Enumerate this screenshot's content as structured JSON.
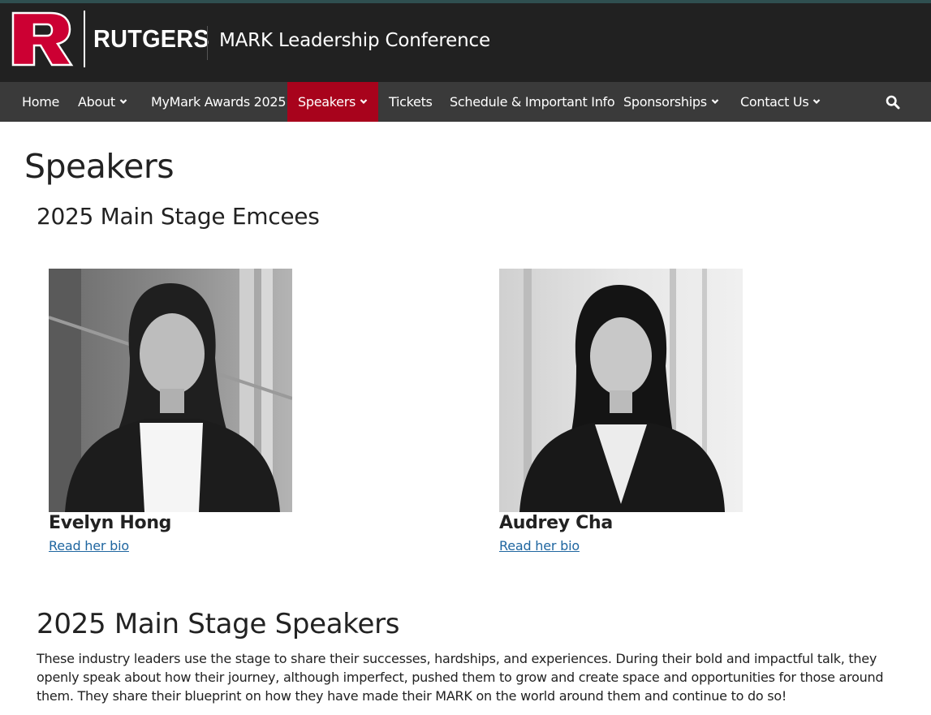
{
  "header": {
    "logo_word": "RUTGERS",
    "site_title": "MARK Leadership Conference",
    "brand_color": "#cc0033"
  },
  "nav": {
    "items": [
      {
        "label": "Home",
        "has_dropdown": false,
        "active": false
      },
      {
        "label": "About",
        "has_dropdown": true,
        "active": false
      },
      {
        "label": "MyMark Awards 2025",
        "has_dropdown": false,
        "active": false
      },
      {
        "label": "Speakers",
        "has_dropdown": true,
        "active": true
      },
      {
        "label": "Tickets",
        "has_dropdown": false,
        "active": false
      },
      {
        "label": "Schedule & Important Info",
        "has_dropdown": false,
        "active": false
      },
      {
        "label": "Sponsorships",
        "has_dropdown": true,
        "active": false
      },
      {
        "label": "Contact Us",
        "has_dropdown": true,
        "active": false
      }
    ],
    "search_icon": "search-icon",
    "active_color": "#a8031c"
  },
  "main": {
    "page_title": "Speakers",
    "emcees_title": "2025 Main Stage Emcees",
    "emcees": [
      {
        "name": "Evelyn Hong",
        "link_text": "Read her bio"
      },
      {
        "name": "Audrey Cha",
        "link_text": "Read her bio"
      }
    ],
    "speakers_title": "2025 Main Stage Speakers",
    "speakers_intro": "These industry leaders use the stage to share their successes, hardships, and experiences. During their bold and impactful talk, they openly speak about how their journey, although imperfect, pushed them to grow and create space and opportunities for those around them. They share their blueprint on how they have made their MARK on the world around them and continue to do so!"
  }
}
